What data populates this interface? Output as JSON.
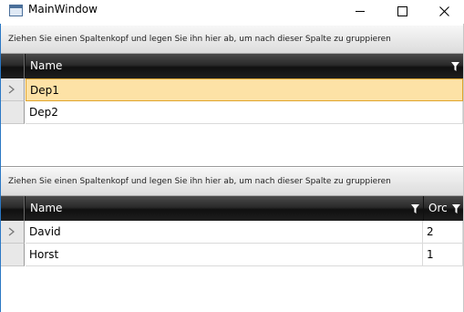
{
  "window": {
    "title": "MainWindow",
    "controls": [
      "minimize",
      "maximize",
      "close"
    ]
  },
  "grid1": {
    "group_hint": "Ziehen Sie einen Spaltenkopf und legen Sie ihn hier ab, um nach dieser Spalte zu gruppieren",
    "columns": [
      {
        "label": "Name",
        "filter_icon": "filter-icon"
      }
    ],
    "rows": [
      {
        "name": "Dep1",
        "current": true,
        "selected": true
      },
      {
        "name": "Dep2",
        "current": false,
        "selected": false
      }
    ]
  },
  "grid2": {
    "group_hint": "Ziehen Sie einen Spaltenkopf und legen Sie ihn hier ab, um nach dieser Spalte zu gruppieren",
    "columns": [
      {
        "label": "Name",
        "filter_icon": "filter-icon"
      },
      {
        "label": "Orc",
        "filter_icon": "filter-icon"
      }
    ],
    "rows": [
      {
        "name": "David",
        "order": "2",
        "current": true
      },
      {
        "name": "Horst",
        "order": "1",
        "current": false
      }
    ]
  },
  "colors": {
    "header_bg": "#1e1e1e",
    "selected_cell_bg": "#fde2a6",
    "selected_cell_border": "#e0a42c",
    "window_border": "#2b78c4"
  }
}
